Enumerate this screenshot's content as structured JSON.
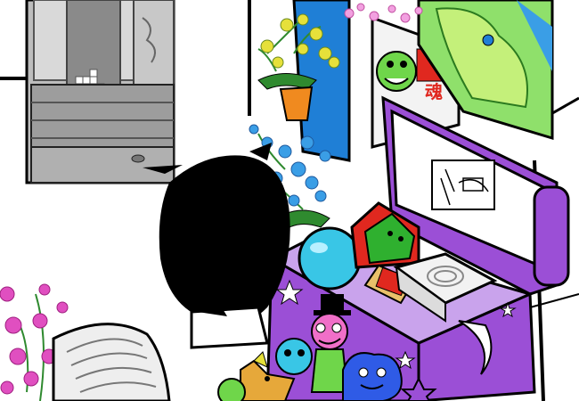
{
  "scene": {
    "style": "Homestuck-style pixel room panel",
    "poster_text": "魂",
    "colors": {
      "outline": "#000000",
      "wall": "#ffffff",
      "chest_purple": "#9b4fd6",
      "chest_light": "#c9a3ec",
      "poster_green": "#6fd64a",
      "poster_blue": "#1f7fd6",
      "orchid_yellow": "#e6e03a",
      "orchid_blue": "#3a9ee6",
      "orchid_pink": "#e04fc0",
      "sphere_cyan": "#39c6e6",
      "house_red": "#e0281f",
      "plush_blue": "#2f5be6",
      "clown_pink": "#f06fc8",
      "dresser_gray": "#a8a8a8"
    }
  }
}
